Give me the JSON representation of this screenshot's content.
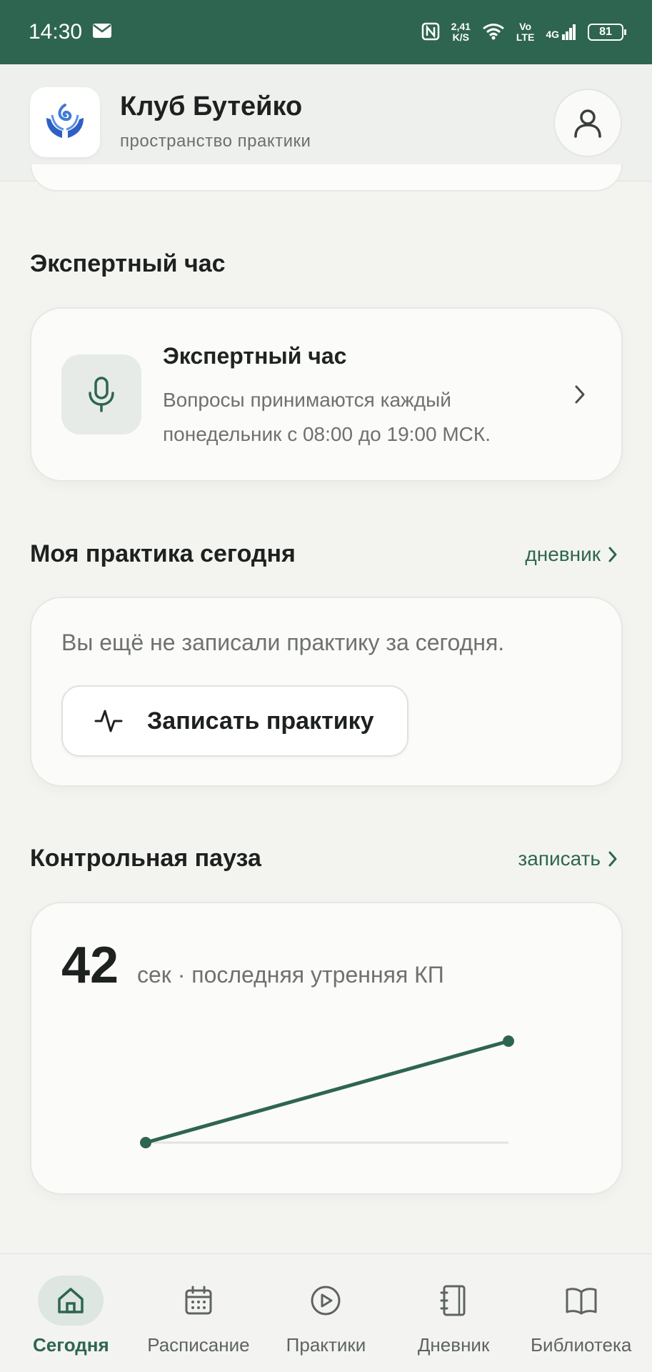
{
  "status_bar": {
    "time": "14:30",
    "net_speed_value": "2,41",
    "net_speed_unit": "K/S",
    "volte_top": "Vo",
    "volte_bottom": "LTE",
    "network": "4G",
    "battery": "81"
  },
  "header": {
    "title": "Клуб Бутейко",
    "subtitle": "пространство практики"
  },
  "expert_section": {
    "heading": "Экспертный час",
    "card_title": "Экспертный час",
    "card_text": "Вопросы принимаются каждый понедельник с 08:00 до 19:00 МСК."
  },
  "practice_section": {
    "heading": "Моя практика сегодня",
    "link": "дневник",
    "empty_text": "Вы ещё не записали практику за сегодня.",
    "button_label": "Записать практику"
  },
  "control_pause": {
    "heading": "Контрольная пауза",
    "link": "записать",
    "value": "42",
    "caption": "сек · последняя утренняя КП"
  },
  "chart_data": {
    "type": "line",
    "x": [
      1,
      2
    ],
    "values": [
      null,
      42
    ],
    "line_color": "#2e6551"
  },
  "bottom_nav": {
    "items": [
      {
        "label": "Сегодня",
        "icon": "home-icon",
        "active": true
      },
      {
        "label": "Расписание",
        "icon": "calendar-icon",
        "active": false
      },
      {
        "label": "Практики",
        "icon": "play-circle-icon",
        "active": false
      },
      {
        "label": "Дневник",
        "icon": "notebook-icon",
        "active": false
      },
      {
        "label": "Библиотека",
        "icon": "book-icon",
        "active": false
      }
    ]
  },
  "colors": {
    "accent": "#2e6551",
    "background": "#f3f4f0",
    "card": "#fbfbf9"
  }
}
